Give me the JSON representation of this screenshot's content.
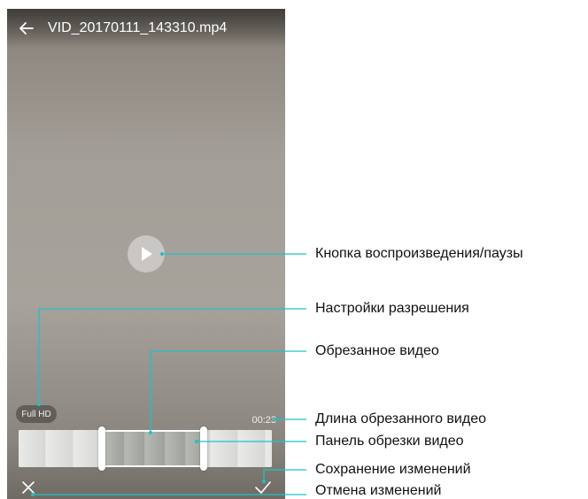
{
  "video_editor": {
    "file_title": "VID_20170111_143310.mp4",
    "resolution_badge": "Full HD",
    "trimmed_duration": "00:23",
    "icons": {
      "back": "arrow-left-icon",
      "play": "play-icon",
      "cancel": "close-icon",
      "save": "checkmark-icon"
    },
    "trim_selection": {
      "start_fraction": 0.33,
      "end_fraction": 0.74
    }
  },
  "callouts": {
    "play_pause": "Кнопка воспроизведения/паузы",
    "resolution": "Настройки разрешения",
    "trimmed_video": "Обрезанное видео",
    "trimmed_length": "Длина обрезанного видео",
    "trim_panel": "Панель обрезки видео",
    "save_changes": "Сохранение изменений",
    "cancel_changes": "Отмена изменений"
  },
  "colors": {
    "callout_line": "#1ec2c8",
    "label_text": "#111111"
  }
}
